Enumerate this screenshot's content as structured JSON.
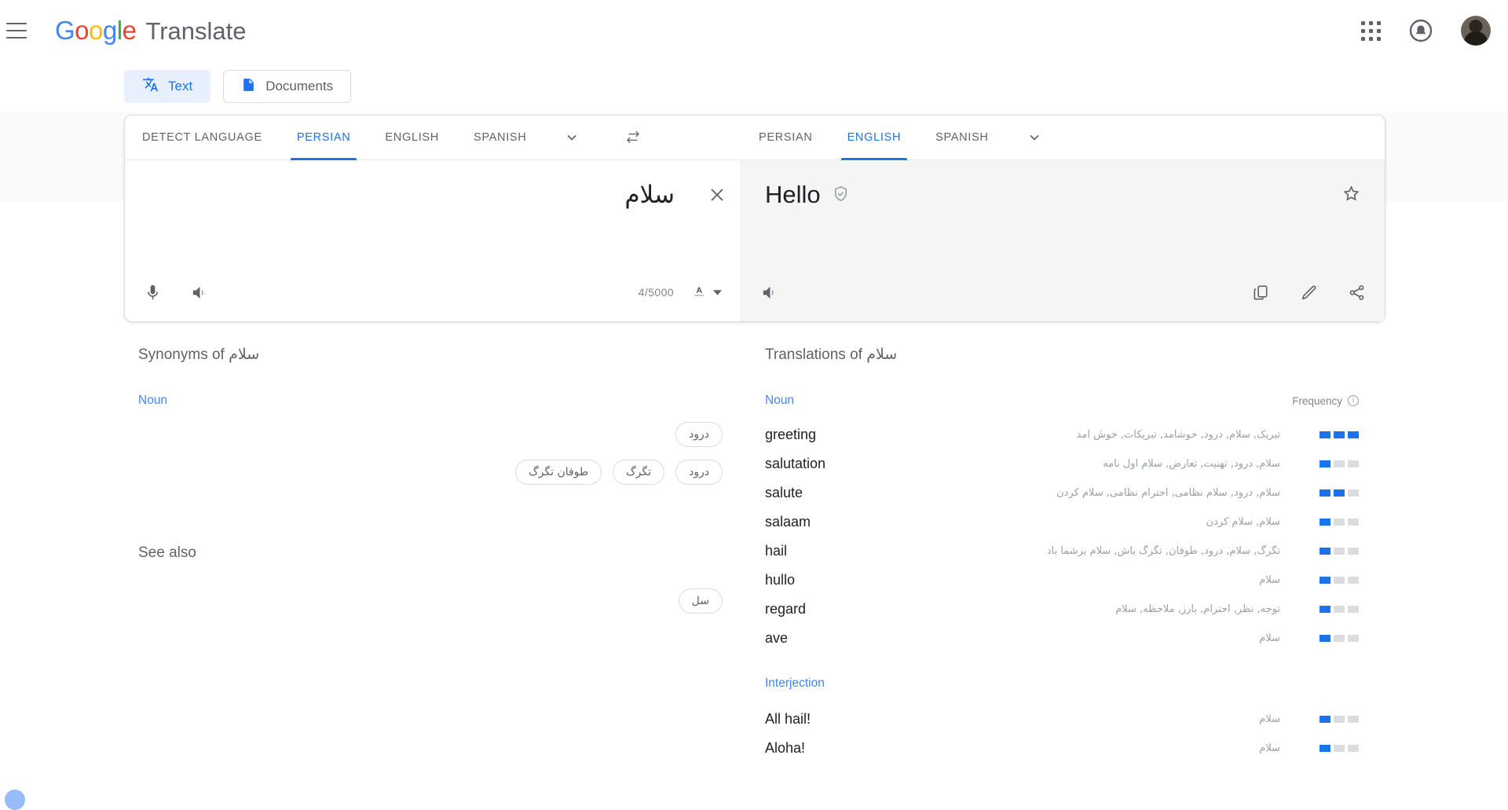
{
  "header": {
    "menu_icon": "hamburger-menu-icon",
    "logo_text": "Google",
    "product_name": "Translate",
    "apps_icon": "apps-grid-icon",
    "notifications_icon": "notification-bell-icon",
    "account_icon": "user-avatar"
  },
  "mode_tabs": [
    {
      "label": "Text",
      "icon": "translate-text-icon",
      "active": true
    },
    {
      "label": "Documents",
      "icon": "document-icon",
      "active": false
    }
  ],
  "source": {
    "tabs": [
      "DETECT LANGUAGE",
      "PERSIAN",
      "ENGLISH",
      "SPANISH"
    ],
    "active_tab": "PERSIAN",
    "more_icon": "chevron-down-icon",
    "text": "سلام",
    "clear_icon": "close-icon",
    "mic_icon": "microphone-icon",
    "listen_icon": "speaker-icon",
    "char_count": "4/5000",
    "keyboard_icon": "input-tool-icon",
    "keyboard_caret": "caret-down-icon"
  },
  "swap_icon": "swap-languages-icon",
  "target": {
    "tabs": [
      "PERSIAN",
      "ENGLISH",
      "SPANISH"
    ],
    "active_tab": "ENGLISH",
    "more_icon": "chevron-down-icon",
    "text": "Hello",
    "verified_icon": "verified-shield-icon",
    "star_icon": "star-outline-icon",
    "listen_icon": "speaker-icon",
    "copy_icon": "copy-icon",
    "edit_icon": "pencil-edit-icon",
    "share_icon": "share-icon"
  },
  "synonyms": {
    "title_prefix": "Synonyms of",
    "title_word": "سلام",
    "pos": "Noun",
    "rows": [
      [
        "درود"
      ],
      [
        "درود",
        "تگرگ",
        "طوفان تگرگ"
      ]
    ],
    "see_also": {
      "title": "See also",
      "chips": [
        "سل"
      ]
    }
  },
  "translations": {
    "title_prefix": "Translations of",
    "title_word": "سلام",
    "frequency_label": "Frequency",
    "frequency_info_icon": "info-icon",
    "groups": [
      {
        "pos": "Noun",
        "items": [
          {
            "word": "greeting",
            "back": "تبریک, سلام, درود, خوشامد, تبریکات, خوش آمد",
            "frequency": 3
          },
          {
            "word": "salutation",
            "back": "سلام, درود, تهنیت, تعارض, سلام اول نامه",
            "frequency": 1
          },
          {
            "word": "salute",
            "back": "سلام, درود, سلام نظامی, احترام نظامی, سلام کردن",
            "frequency": 2
          },
          {
            "word": "salaam",
            "back": "سلام, سلام کردن",
            "frequency": 1
          },
          {
            "word": "hail",
            "back": "تگرگ, سلام, درود, طوفان, تگرگ باش, سلام برشما باد",
            "frequency": 1
          },
          {
            "word": "hullo",
            "back": "سلام",
            "frequency": 1
          },
          {
            "word": "regard",
            "back": "توجه, نظر, احترام, بارز, ملاحظه, سلام",
            "frequency": 1
          },
          {
            "word": "ave",
            "back": "سلام",
            "frequency": 1
          }
        ]
      },
      {
        "pos": "Interjection",
        "items": [
          {
            "word": "All hail!",
            "back": "سلام",
            "frequency": 1
          },
          {
            "word": "Aloha!",
            "back": "سلام",
            "frequency": 1
          }
        ]
      }
    ],
    "frequency_max": 3
  },
  "colors": {
    "accent": "#1a73e8",
    "accent_light": "#e8f0fe",
    "text_primary": "#202124",
    "text_secondary": "#5f6368",
    "muted": "#9aa0a6",
    "border": "#dadce0",
    "pane_bg": "#f5f5f5"
  }
}
